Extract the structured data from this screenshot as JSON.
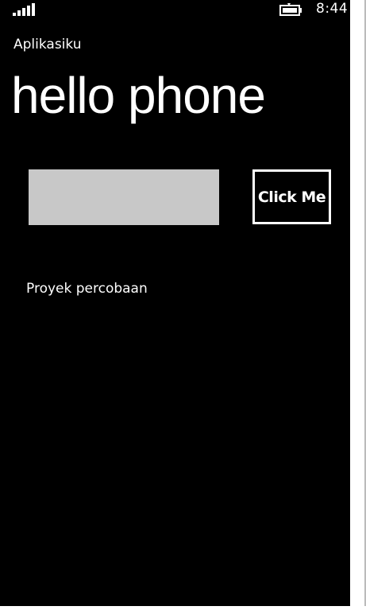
{
  "status_bar": {
    "time": "8:44",
    "signal_icon": "signal-strength-icon",
    "battery_icon": "battery-icon"
  },
  "app": {
    "title": "Aplikasiku",
    "page_title": "hello phone"
  },
  "form": {
    "input_value": "",
    "button_label": "Click Me"
  },
  "content": {
    "label": "Proyek percobaan"
  },
  "colors": {
    "background": "#000000",
    "foreground": "#ffffff",
    "input_background": "#c8c8c8"
  }
}
